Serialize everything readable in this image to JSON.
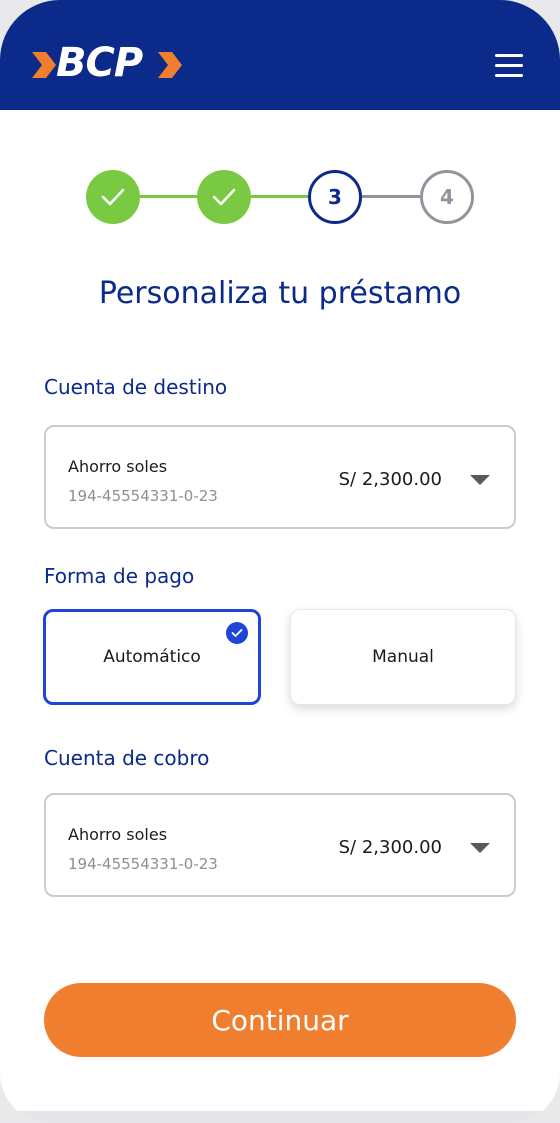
{
  "header": {
    "logo_text": "BCP",
    "menu_icon": "hamburger-menu-icon",
    "brand_color": "#0c2a8a",
    "accent_color": "#ef7f2f"
  },
  "stepper": {
    "steps": [
      {
        "state": "done",
        "label": ""
      },
      {
        "state": "done",
        "label": ""
      },
      {
        "state": "active",
        "label": "3"
      },
      {
        "state": "todo",
        "label": "4"
      }
    ],
    "done_color": "#7ac943",
    "todo_color": "#8f959c"
  },
  "page": {
    "title": "Personaliza tu préstamo"
  },
  "destination": {
    "section_label": "Cuenta de destino",
    "account_name": "Ahorro soles",
    "account_number": "194-45554331-0-23",
    "balance": "S/ 2,300.00"
  },
  "payment_method": {
    "section_label": "Forma de pago",
    "options": [
      {
        "label": "Automático",
        "selected": true
      },
      {
        "label": "Manual",
        "selected": false
      }
    ]
  },
  "collection": {
    "section_label": "Cuenta de cobro",
    "account_name": "Ahorro soles",
    "account_number": "194-45554331-0-23",
    "balance": "S/ 2,300.00"
  },
  "actions": {
    "continue_label": "Continuar"
  }
}
